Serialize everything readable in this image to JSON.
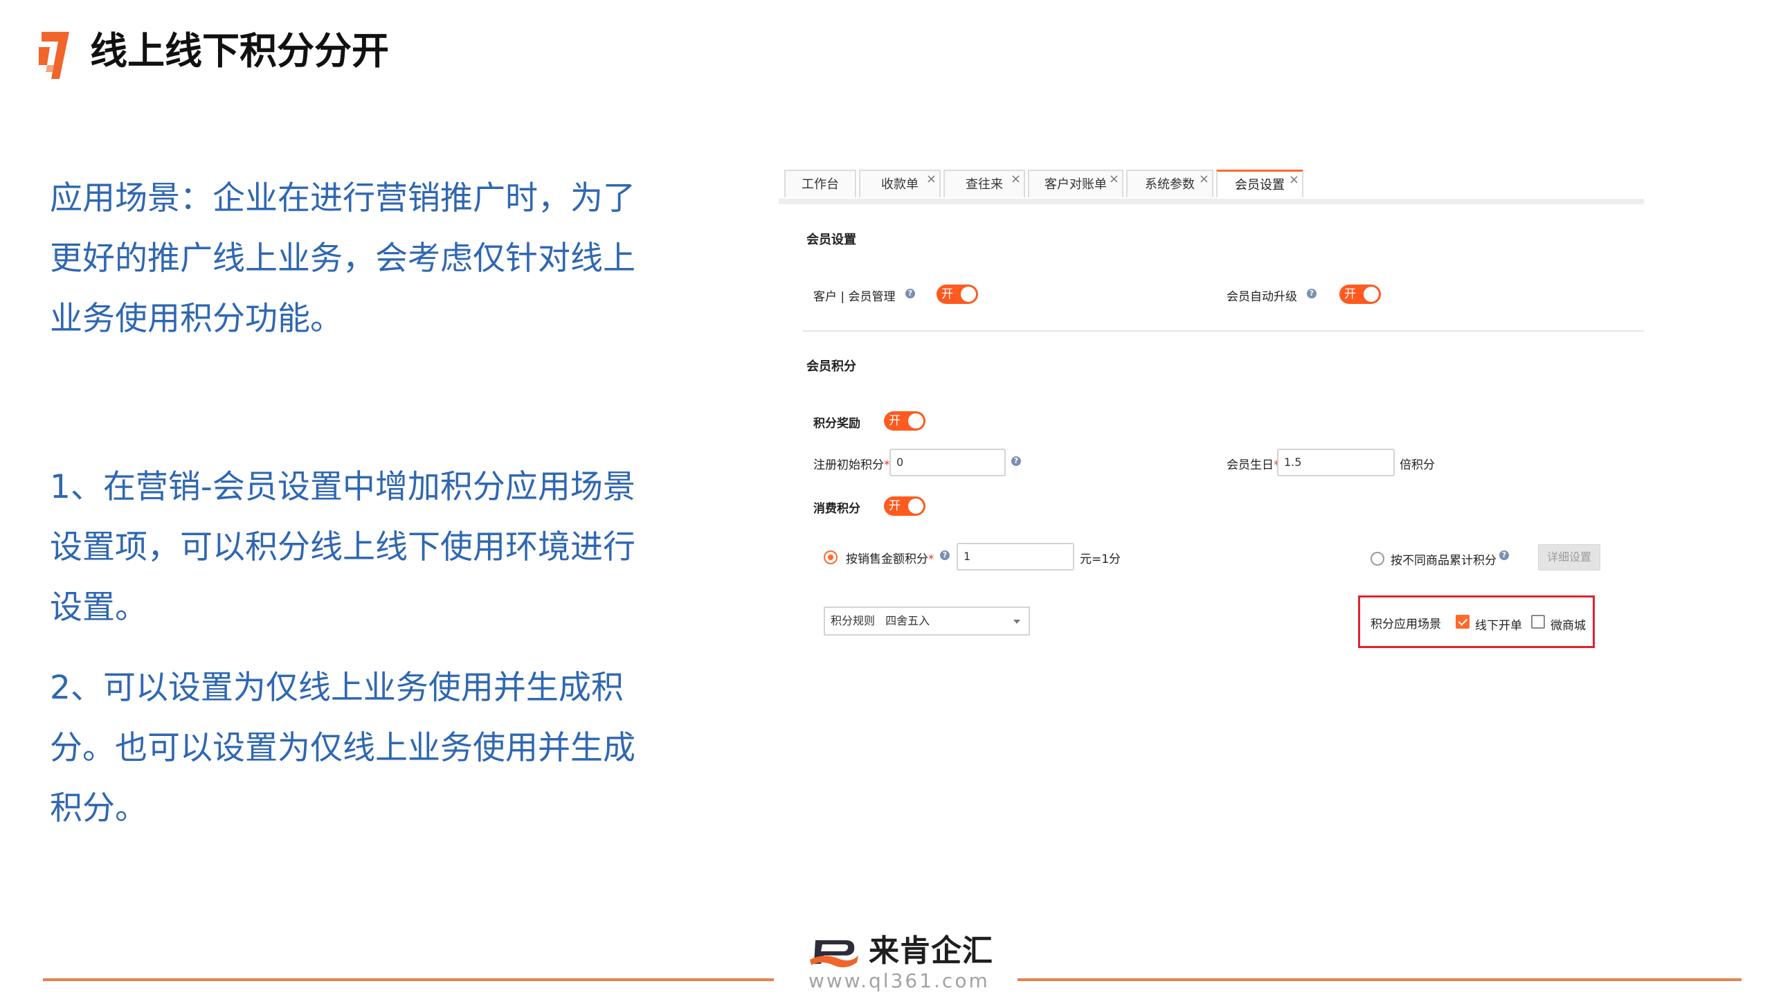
{
  "slide": {
    "title": "线上线下积分分开"
  },
  "left_text": {
    "intro": " 应用场景：企业在进行营销推广时，为了更好的推广线上业务，会考虑仅针对线上业务使用积分功能。",
    "point1": "1、在营销-会员设置中增加积分应用场景设置项，可以积分线上线下使用环境进行设置。",
    "point2": "2、可以设置为仅线上业务使用并生成积分。也可以设置为仅线上业务使用并生成积分。"
  },
  "tabs": [
    {
      "label": "工作台",
      "closable": false,
      "active": false
    },
    {
      "label": "收款单",
      "closable": true,
      "active": false
    },
    {
      "label": "查往来",
      "closable": true,
      "active": false
    },
    {
      "label": "客户对账单",
      "closable": true,
      "active": false
    },
    {
      "label": "系统参数",
      "closable": true,
      "active": false
    },
    {
      "label": "会员设置",
      "closable": true,
      "active": true
    }
  ],
  "tab_close_symbol": "×",
  "member_settings": {
    "section_title": "会员设置",
    "customer_member_mgmt": {
      "label": "客户 | 会员管理",
      "toggle": "开"
    },
    "member_auto_upgrade": {
      "label": "会员自动升级",
      "toggle": "开"
    }
  },
  "member_points": {
    "section_title": "会员积分",
    "points_reward": {
      "label": "积分奖励",
      "toggle": "开"
    },
    "register_initial": {
      "label": "注册初始积分",
      "value": "0"
    },
    "member_birthday": {
      "label": "会员生日",
      "value": "1.5",
      "suffix": "倍积分"
    },
    "consume_points": {
      "label": "消费积分",
      "toggle": "开"
    },
    "by_sales_amount": {
      "label": "按销售金额积分",
      "value": "1",
      "suffix": "元=1分",
      "selected": true
    },
    "by_product_cumulative": {
      "label": "按不同商品累计积分",
      "selected": false
    },
    "detail_button": "详细设置",
    "rule_select": {
      "label": "积分规则",
      "value": "四舍五入"
    },
    "scenario": {
      "label": "积分应用场景",
      "offline_order": {
        "label": "线下开单",
        "checked": true
      },
      "micro_mall": {
        "label": "微商城",
        "checked": false
      }
    }
  },
  "help_icon_glyph": "?",
  "required_mark": "*",
  "footer": {
    "brand_name": "来肯企汇",
    "url": "www.ql361.com"
  },
  "colors": {
    "accent": "#ff6a2a",
    "text_blue": "#2f67b2",
    "highlight_red": "#e3222d",
    "footer_line": "#e8804e"
  },
  "icons": {
    "title_logo": "orange-bracket-logo",
    "brand_mark": "laiken-logo-mark"
  }
}
